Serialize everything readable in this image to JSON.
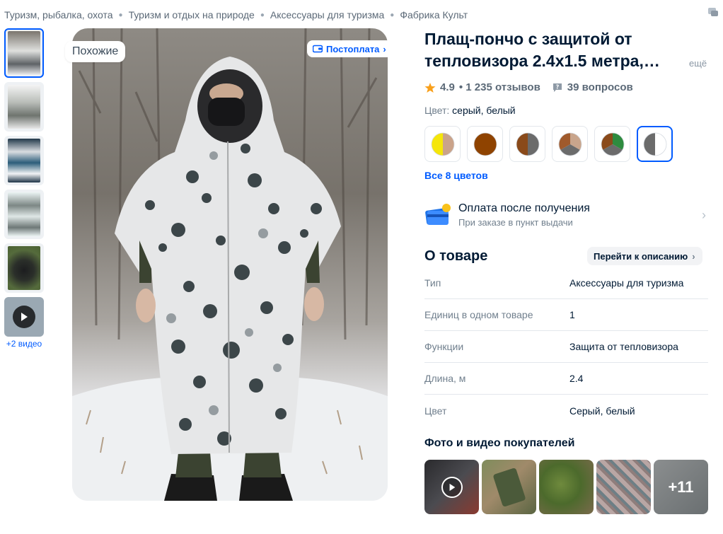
{
  "breadcrumb": [
    "Туризм, рыбалка, охота",
    "Туризм и отдых на природе",
    "Аксессуары для туризма",
    "Фабрика Культ"
  ],
  "gallery": {
    "video_count_label": "+2 видео",
    "similar_label": "Похожие",
    "postpay_label": "Постоплата"
  },
  "product": {
    "title": "Плащ-пончо с защитой от тепловизора 2.4х1.5 метра,…",
    "more_label": "ещё",
    "rating": "4.9",
    "reviews": "• 1 235 отзывов",
    "questions": "39 вопросов",
    "color_label": "Цвет:",
    "color_value": "серый, белый",
    "all_colors_label": "Все 8 цветов",
    "swatches": [
      {
        "left": "#f5e60a",
        "right": "#caa38a"
      },
      {
        "left": "#8f4300",
        "right": "#8f4300"
      },
      {
        "left": "#8a4a1a",
        "right": "#6b6b6b"
      },
      {
        "left": "#a05a2c",
        "right": "#c9a58c",
        "third": "#6b6b6b"
      },
      {
        "left": "#8a4a1a",
        "right": "#2e8b3f",
        "third": "#6b6b6b"
      },
      {
        "left": "#6b6b6b",
        "right": "#ffffff"
      }
    ]
  },
  "payment": {
    "title": "Оплата после получения",
    "subtitle": "При заказе в пункт выдачи"
  },
  "about": {
    "heading": "О товаре",
    "to_description": "Перейти к описанию",
    "specs": [
      {
        "key": "Тип",
        "value": "Аксессуары для туризма"
      },
      {
        "key": "Единиц в одном товаре",
        "value": "1"
      },
      {
        "key": "Функции",
        "value": "Защита от тепловизора"
      },
      {
        "key": "Длина, м",
        "value": "2.4"
      },
      {
        "key": "Цвет",
        "value": "Серый, белый"
      }
    ]
  },
  "ugc": {
    "heading": "Фото и видео покупателей",
    "more_count": "+11"
  },
  "colors": {
    "accent": "#005bff",
    "text": "#001a34",
    "muted": "#707f8d",
    "star": "#f9a01b"
  }
}
